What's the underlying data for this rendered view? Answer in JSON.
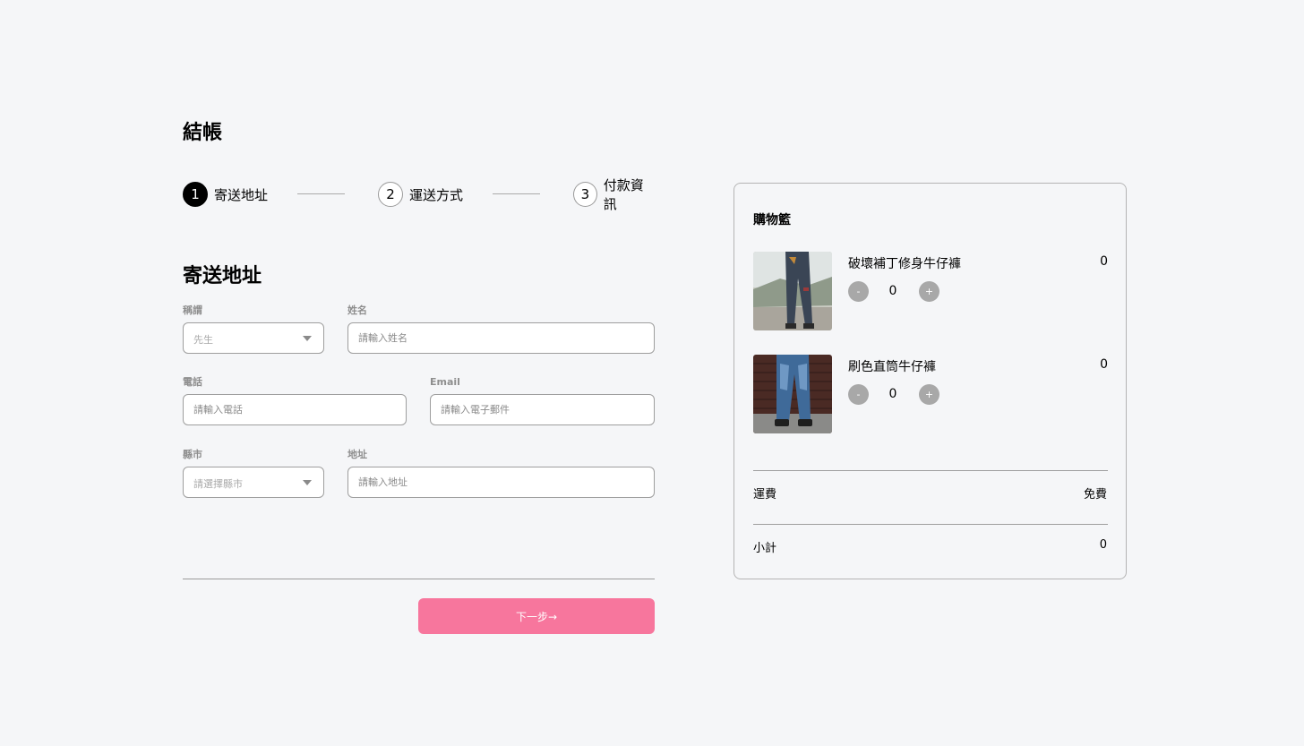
{
  "page": {
    "title": "結帳"
  },
  "stepper": {
    "steps": [
      {
        "number": "1",
        "label": "寄送地址"
      },
      {
        "number": "2",
        "label": "運送方式"
      },
      {
        "number": "3",
        "label": "付款資訊"
      }
    ],
    "active_step": 1
  },
  "form": {
    "section_title": "寄送地址",
    "salutation": {
      "label": "稱謂",
      "value": "先生"
    },
    "name": {
      "label": "姓名",
      "placeholder": "請輸入姓名"
    },
    "phone": {
      "label": "電話",
      "placeholder": "請輸入電話"
    },
    "email": {
      "label": "Email",
      "placeholder": "請輸入電子郵件"
    },
    "city": {
      "label": "縣市",
      "placeholder": "請選擇縣市"
    },
    "address": {
      "label": "地址",
      "placeholder": "請輸入地址"
    }
  },
  "actions": {
    "next_label": "下一步→",
    "accent_color": "#f7769d"
  },
  "cart": {
    "title": "購物籃",
    "items": [
      {
        "name": "破壞補丁修身牛仔褲",
        "price": "0",
        "quantity": "0",
        "minus": "-",
        "plus": "+"
      },
      {
        "name": "刷色直筒牛仔褲",
        "price": "0",
        "quantity": "0",
        "minus": "-",
        "plus": "+"
      }
    ],
    "shipping": {
      "label": "運費",
      "value": "免費"
    },
    "subtotal": {
      "label": "小計",
      "value": "0"
    }
  }
}
